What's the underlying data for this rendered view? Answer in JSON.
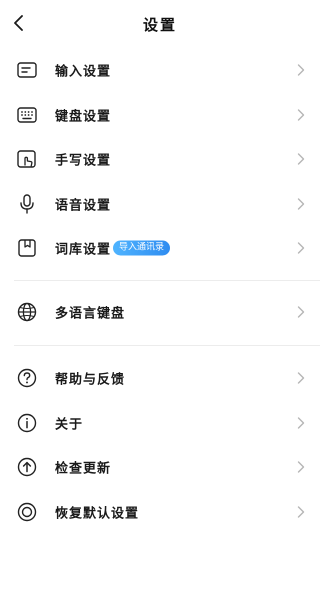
{
  "header": {
    "title": "设置",
    "back_icon": "chevron-left-icon"
  },
  "group1": [
    {
      "label": "输入设置",
      "icon": "input-box-icon"
    },
    {
      "label": "键盘设置",
      "icon": "keyboard-icon"
    },
    {
      "label": "手写设置",
      "icon": "handwriting-icon"
    },
    {
      "label": "语音设置",
      "icon": "microphone-icon"
    },
    {
      "label": "词库设置",
      "icon": "dictionary-icon",
      "badge": "导入通讯录"
    }
  ],
  "group2": [
    {
      "label": "多语言键盘",
      "icon": "globe-icon"
    }
  ],
  "group3": [
    {
      "label": "帮助与反馈",
      "icon": "question-icon"
    },
    {
      "label": "关于",
      "icon": "info-icon"
    },
    {
      "label": "检查更新",
      "icon": "update-arrow-icon"
    },
    {
      "label": "恢复默认设置",
      "icon": "restore-icon"
    }
  ],
  "colors": {
    "badge_start": "#4fb4ff",
    "badge_end": "#2f8cf0",
    "divider": "#ececec",
    "chevron": "#b5b5b5"
  }
}
